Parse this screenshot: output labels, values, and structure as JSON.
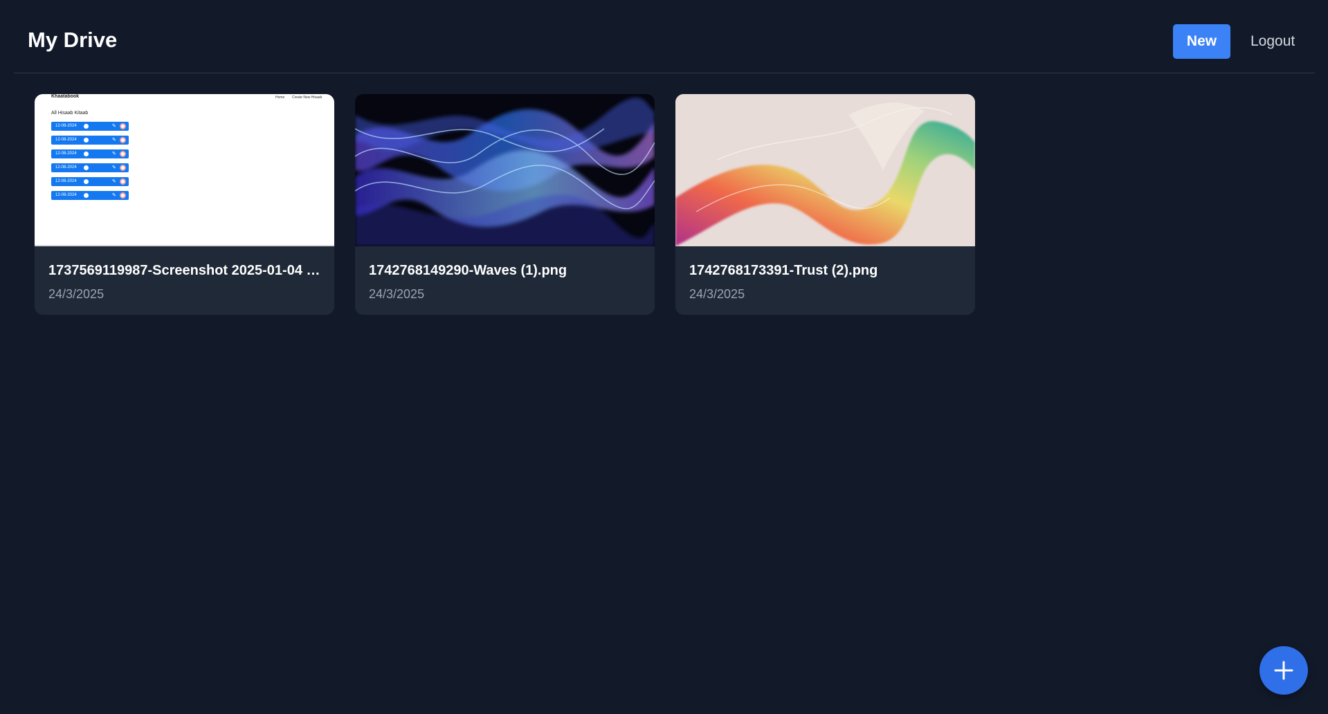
{
  "header": {
    "title": "My Drive",
    "new_label": "New",
    "logout_label": "Logout"
  },
  "files": [
    {
      "name": "1737569119987-Screenshot 2025-01-04 2...",
      "date": "24/3/2025",
      "thumbnail": "screenshot",
      "preview": {
        "brand": "Khaatabook",
        "nav": [
          "Home",
          "Create New Hisaab"
        ],
        "heading": "All Hisaab Kitaab",
        "rows": [
          "12-08-2024",
          "12-08-2024",
          "12-08-2024",
          "12-08-2024",
          "12-08-2024",
          "12-08-2024"
        ]
      }
    },
    {
      "name": "1742768149290-Waves (1).png",
      "date": "24/3/2025",
      "thumbnail": "blue-waves-image"
    },
    {
      "name": "1742768173391-Trust (2).png",
      "date": "24/3/2025",
      "thumbnail": "rainbow-ribbon-image"
    }
  ],
  "fab": {
    "icon": "plus-icon"
  },
  "colors": {
    "background": "#121a2a",
    "card": "#1f2937",
    "accent": "#3b82f6",
    "fab": "#2f6fe8"
  }
}
